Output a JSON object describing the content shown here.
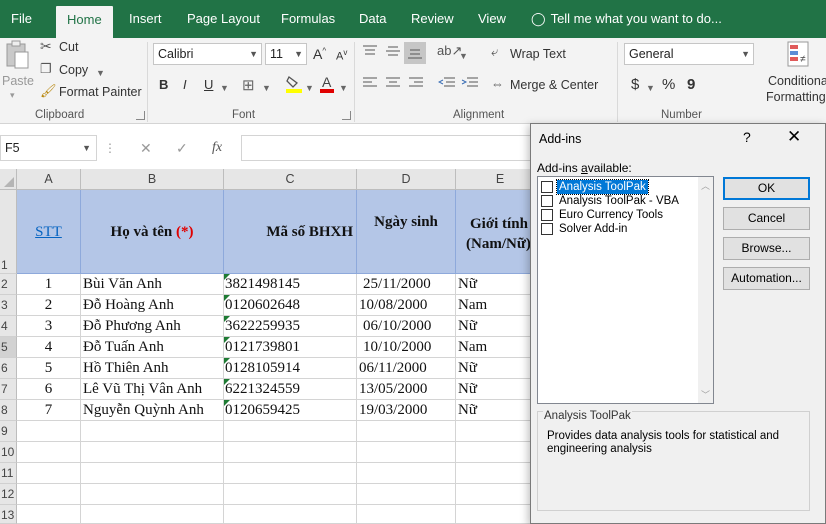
{
  "ribbon_tabs": [
    "File",
    "Home",
    "Insert",
    "Page Layout",
    "Formulas",
    "Data",
    "Review",
    "View"
  ],
  "tell_me": "Tell me what you want to do...",
  "clipboard": {
    "paste": "Paste",
    "cut": "Cut",
    "copy": "Copy",
    "format_painter": "Format Painter",
    "group_label": "Clipboard"
  },
  "font": {
    "name": "Calibri",
    "size": "11",
    "bold": "B",
    "italic": "I",
    "underline": "U",
    "grow": "A",
    "shrink": "A",
    "group_label": "Font"
  },
  "alignment": {
    "wrap_text": "Wrap Text",
    "merge_center": "Merge & Center",
    "group_label": "Alignment"
  },
  "number": {
    "format": "General",
    "currency": "$",
    "percent": "%",
    "comma": "9",
    "group_label": "Number"
  },
  "styles": {
    "conditional_formatting_line1": "Conditional",
    "conditional_formatting_line2": "Formatting"
  },
  "formula_bar": {
    "name_box": "F5",
    "cancel": "✕",
    "enter": "✓",
    "fx": "fx",
    "formula": ""
  },
  "columns": [
    "A",
    "B",
    "C",
    "D",
    "E"
  ],
  "rows": [
    "1",
    "2",
    "3",
    "4",
    "5",
    "6",
    "7",
    "8",
    "9",
    "10",
    "11",
    "12",
    "13"
  ],
  "table_headers": {
    "stt": "STT",
    "name": "Họ và tên",
    "name_mark": "(*)",
    "bhxh": "Mã số BHXH",
    "dob": "Ngày sinh",
    "gender_line1": "Giới tính",
    "gender_line2": "(Nam/Nữ)"
  },
  "table_rows": [
    {
      "stt": "1",
      "name": "Bùi Văn Anh",
      "bhxh": "3821498145",
      "dob": "25/11/2000",
      "gender": "Nữ"
    },
    {
      "stt": "2",
      "name": "Đỗ Hoàng Anh",
      "bhxh": "0120602648",
      "dob": "10/08/2000",
      "gender": "Nam"
    },
    {
      "stt": "3",
      "name": "Đỗ Phương Anh",
      "bhxh": "3622259935",
      "dob": "06/10/2000",
      "gender": "Nữ"
    },
    {
      "stt": "4",
      "name": "Đỗ Tuấn Anh",
      "bhxh": "0121739801",
      "dob": "10/10/2000",
      "gender": "Nam"
    },
    {
      "stt": "5",
      "name": "Hồ Thiên Anh",
      "bhxh": "0128105914",
      "dob": "06/11/2000",
      "gender": "Nữ"
    },
    {
      "stt": "6",
      "name": "Lê Vũ Thị Vân Anh",
      "bhxh": "6221324559",
      "dob": "13/05/2000",
      "gender": "Nữ"
    },
    {
      "stt": "7",
      "name": "Nguyễn Quỳnh Anh",
      "bhxh": "0120659425",
      "dob": "19/03/2000",
      "gender": "Nữ"
    }
  ],
  "dialog": {
    "title": "Add-ins",
    "help": "?",
    "close": "✕",
    "available_label": "Add-ins available:",
    "items": [
      {
        "label": "Analysis ToolPak",
        "checked": false,
        "selected": true
      },
      {
        "label": "Analysis ToolPak - VBA",
        "checked": false,
        "selected": false
      },
      {
        "label": "Euro Currency Tools",
        "checked": false,
        "selected": false
      },
      {
        "label": "Solver Add-in",
        "checked": false,
        "selected": false
      }
    ],
    "ok": "OK",
    "cancel": "Cancel",
    "browse": "Browse...",
    "automation": "Automation...",
    "description_title": "Analysis ToolPak",
    "description": "Provides data analysis tools for statistical and engineering analysis"
  },
  "colors": {
    "excel_green": "#217346",
    "header_fill": "#b4c6e7",
    "selection_blue": "#0078d7",
    "stt_link_blue": "#0563c1",
    "required_mark_red": "#e00000"
  }
}
